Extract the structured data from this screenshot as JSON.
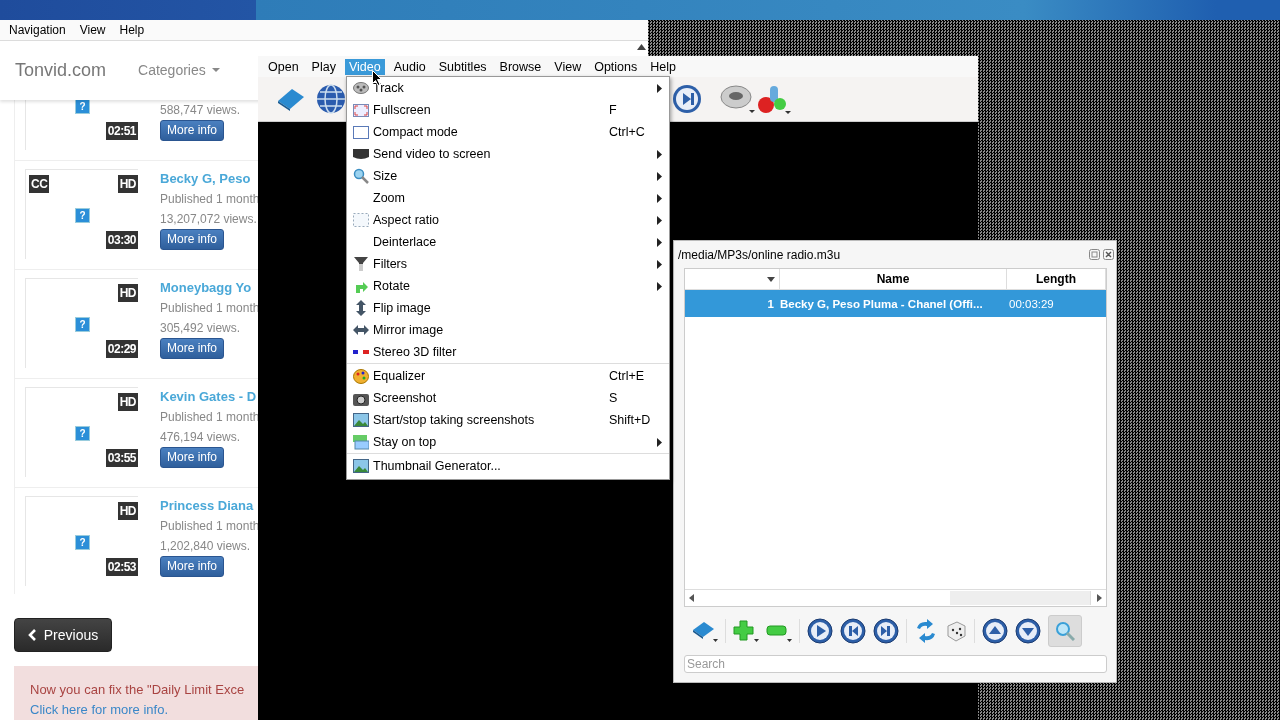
{
  "browser": {
    "menu": [
      "Navigation",
      "View",
      "Help"
    ]
  },
  "site": {
    "logo": "Tonvid.com",
    "categories": "Categories",
    "videos": [
      {
        "image_icon": "?",
        "duration": "02:51",
        "views": "588,747 views.",
        "button": "More info"
      },
      {
        "cc_label": "CC",
        "hd_label": "HD",
        "image_icon": "?",
        "duration": "03:30",
        "title": "Becky G, Peso",
        "published": "Published 1 month",
        "views": "13,207,072 views.",
        "button": "More info"
      },
      {
        "hd_label": "HD",
        "image_icon": "?",
        "duration": "02:29",
        "title": "Moneybagg Yo",
        "published": "Published 1 month",
        "views": "305,492 views.",
        "button": "More info"
      },
      {
        "hd_label": "HD",
        "image_icon": "?",
        "duration": "03:55",
        "title": "Kevin Gates - D",
        "published": "Published 1 month",
        "views": "476,194 views.",
        "button": "More info"
      },
      {
        "hd_label": "HD",
        "image_icon": "?",
        "duration": "02:53",
        "title": "Princess Diana",
        "published": "Published 1 month",
        "views": "1,202,840 views.",
        "button": "More info"
      }
    ],
    "previous": "Previous",
    "notice": {
      "text": "Now you can fix the \"Daily Limit Exce",
      "link": "Click here for more info."
    }
  },
  "player": {
    "menu": [
      {
        "label": "Open",
        "selected": false
      },
      {
        "label": "Play",
        "selected": false
      },
      {
        "label": "Video",
        "selected": true
      },
      {
        "label": "Audio",
        "selected": false
      },
      {
        "label": "Subtitles",
        "selected": false
      },
      {
        "label": "Browse",
        "selected": false
      },
      {
        "label": "View",
        "selected": false
      },
      {
        "label": "Options",
        "selected": false
      },
      {
        "label": "Help",
        "selected": false
      }
    ],
    "video_menu": [
      {
        "label": "Track",
        "submenu": true,
        "separator_before": false
      },
      {
        "label": "Fullscreen",
        "shortcut": "F",
        "submenu": false,
        "separator_before": false
      },
      {
        "label": "Compact mode",
        "shortcut": "Ctrl+C",
        "submenu": false,
        "separator_before": false
      },
      {
        "label": "Send video to screen",
        "submenu": true,
        "separator_before": false
      },
      {
        "label": "Size",
        "submenu": true,
        "separator_before": false
      },
      {
        "label": "Zoom",
        "submenu": true,
        "separator_before": false
      },
      {
        "label": "Aspect ratio",
        "submenu": true,
        "separator_before": false
      },
      {
        "label": "Deinterlace",
        "submenu": true,
        "separator_before": false
      },
      {
        "label": "Filters",
        "submenu": true,
        "separator_before": false
      },
      {
        "label": "Rotate",
        "submenu": true,
        "separator_before": false
      },
      {
        "label": "Flip image",
        "submenu": false,
        "separator_before": false
      },
      {
        "label": "Mirror image",
        "submenu": false,
        "separator_before": false
      },
      {
        "label": "Stereo 3D filter",
        "submenu": false,
        "separator_before": false
      },
      {
        "label": "Equalizer",
        "shortcut": "Ctrl+E",
        "submenu": false,
        "separator_before": true
      },
      {
        "label": "Screenshot",
        "shortcut": "S",
        "submenu": false,
        "separator_before": false
      },
      {
        "label": "Start/stop taking screenshots",
        "shortcut": "Shift+D",
        "submenu": false,
        "separator_before": false
      },
      {
        "label": "Stay on top",
        "submenu": true,
        "separator_before": false
      },
      {
        "label": "Thumbnail Generator...",
        "submenu": false,
        "separator_before": true
      }
    ]
  },
  "playlist": {
    "title": "/media/MP3s/online radio.m3u",
    "columns": [
      "Name",
      "Length"
    ],
    "rows": [
      {
        "number": "1",
        "name": "Becky G, Peso Pluma - Chanel (Offi...",
        "length": "00:03:29",
        "selected": true
      }
    ],
    "search": {
      "placeholder": "Search"
    }
  }
}
